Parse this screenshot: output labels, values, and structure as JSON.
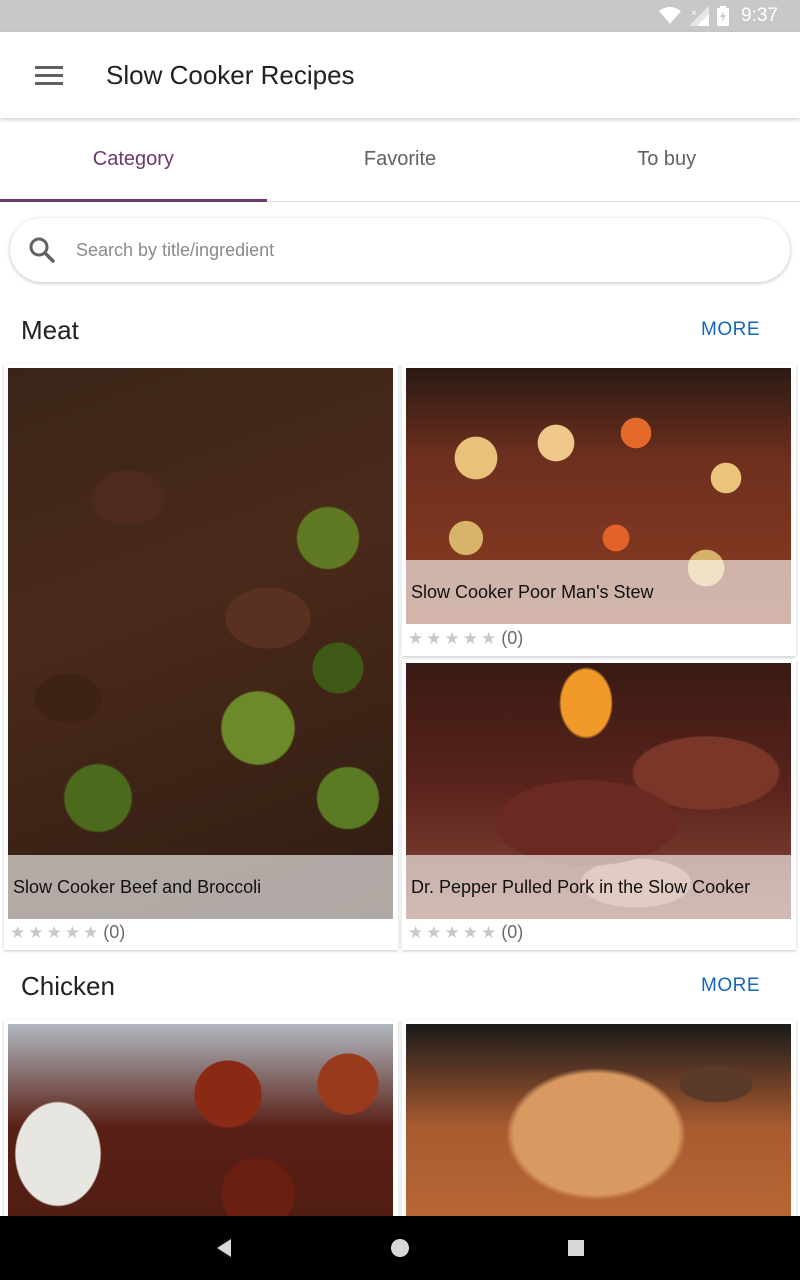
{
  "status_bar": {
    "time": "9:37",
    "icons": [
      "wifi-icon",
      "signal-icon",
      "battery-icon"
    ]
  },
  "app_bar": {
    "title": "Slow Cooker Recipes",
    "menu_icon": "menu-icon"
  },
  "tabs": [
    {
      "label": "Category",
      "active": true
    },
    {
      "label": "Favorite",
      "active": false
    },
    {
      "label": "To buy",
      "active": false
    }
  ],
  "search": {
    "placeholder": "Search by title/ingredient",
    "icon": "search-icon"
  },
  "sections": [
    {
      "title": "Meat",
      "more_label": "MORE",
      "recipes": [
        {
          "title": "Slow Cooker Beef and Broccoli",
          "rating_count": "(0)",
          "stars": 0
        },
        {
          "title": "Slow Cooker Poor Man's Stew",
          "rating_count": "(0)",
          "stars": 0
        },
        {
          "title": "Dr. Pepper Pulled Pork in the Slow Cooker",
          "rating_count": "(0)",
          "stars": 0
        }
      ]
    },
    {
      "title": "Chicken",
      "more_label": "MORE",
      "recipes": [
        {
          "title": "",
          "rating_count": ""
        },
        {
          "title": "",
          "rating_count": ""
        }
      ]
    }
  ],
  "colors": {
    "accent": "#6b3a6b",
    "more_link": "#1565c0",
    "status_bar": "#c8c8c8"
  }
}
